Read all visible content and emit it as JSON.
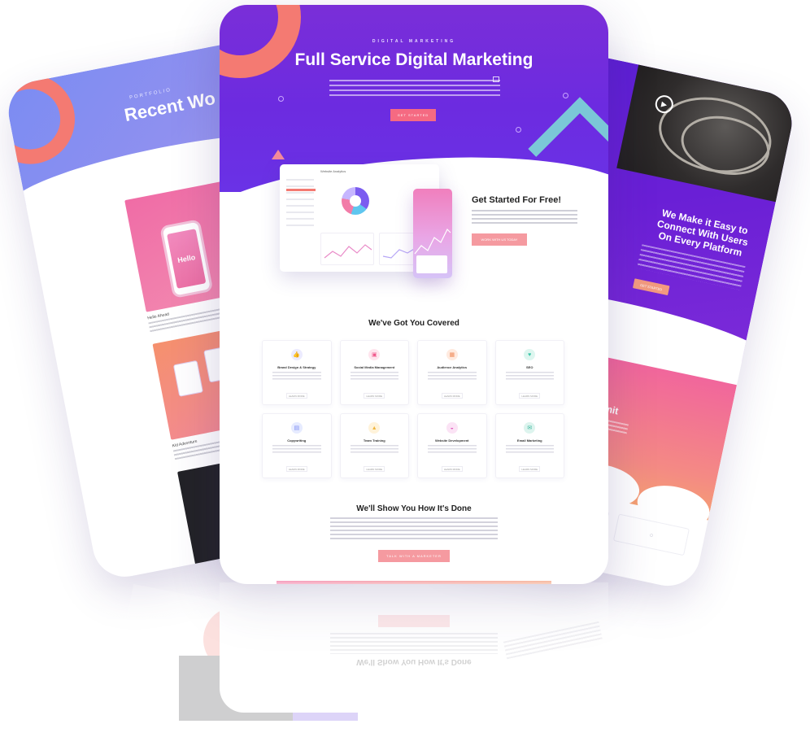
{
  "left_card": {
    "eyebrow": "PORTFOLIO",
    "title": "Recent Wo",
    "phone_text": "Hello",
    "caption_1": "Hello Ahead",
    "caption_2": "Kid Adventure"
  },
  "center_card": {
    "eyebrow": "DIGITAL MARKETING",
    "title": "Full Service Digital Marketing",
    "hero_button": "GET STARTED",
    "dashboard_title": "Website Analytics",
    "get_started_title": "Get Started For Free!",
    "get_started_button": "WORK WITH US TODAY",
    "section1_title": "We've Got You Covered",
    "features": [
      {
        "label": "Brand Design & Strategy",
        "icon": "thumb-icon",
        "color": "#8b7cf6",
        "bg": "#ecebff",
        "glyph": "👍",
        "button": "LEARN MORE"
      },
      {
        "label": "Social Media Management",
        "icon": "briefcase-icon",
        "color": "#f0588c",
        "bg": "#ffe5ee",
        "glyph": "▣",
        "button": "LEARN MORE"
      },
      {
        "label": "Audience Analytics",
        "icon": "calendar-icon",
        "color": "#f08a5a",
        "bg": "#ffeadf",
        "glyph": "▦",
        "button": "LEARN MORE"
      },
      {
        "label": "SEO",
        "icon": "heart-icon",
        "color": "#3cc5a8",
        "bg": "#ddf6ef",
        "glyph": "♥",
        "button": "LEARN MORE"
      },
      {
        "label": "Copywriting",
        "icon": "document-icon",
        "color": "#7b8cf2",
        "bg": "#e6ebff",
        "glyph": "▤",
        "button": "LEARN MORE"
      },
      {
        "label": "Team Training",
        "icon": "flask-icon",
        "color": "#f0b640",
        "bg": "#fff3da",
        "glyph": "▲",
        "button": "LEARN MORE"
      },
      {
        "label": "Website Development",
        "icon": "chart-icon",
        "color": "#e262c0",
        "bg": "#fbe3f5",
        "glyph": "◒",
        "button": "LEARN MORE"
      },
      {
        "label": "Email Marketing",
        "icon": "mail-icon",
        "color": "#3ab79e",
        "bg": "#ddf4ee",
        "glyph": "✉",
        "button": "LEARN MORE"
      }
    ],
    "section2_title": "We'll Show You How It's Done",
    "section2_button": "TALK WITH A MARKETER"
  },
  "right_card": {
    "heading": "We Make it Easy to Connect With Users On Every Platform",
    "button": "GET STARTED",
    "pink_title": "Sky's the Limit"
  },
  "colors": {
    "purple": "#6c2be0",
    "coral": "#f47a72",
    "pink_button": "#f59aa0",
    "teal": "#7ee3d6"
  }
}
